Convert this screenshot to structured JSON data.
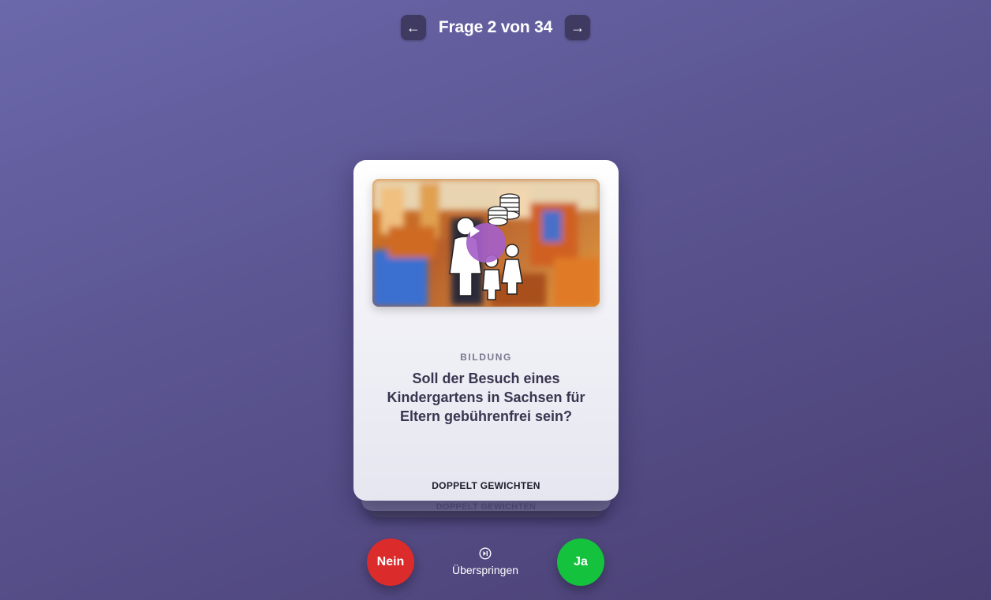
{
  "nav": {
    "prev_icon": "←",
    "next_icon": "→",
    "title": "Frage 2 von 34"
  },
  "card": {
    "thumbnail_icon": "play-icon",
    "category": "BILDUNG",
    "question": "Soll der Besuch eines Kindergartens in Sachsen für Eltern gebührenfrei sein?",
    "weight_label": "DOPPELT GEWICHTEN"
  },
  "stack": {
    "next_card_weight_label": "DOPPELT GEWICHTEN"
  },
  "actions": {
    "no_label": "Nein",
    "skip_label": "Überspringen",
    "yes_label": "Ja"
  },
  "colors": {
    "no": "#dc2b2b",
    "yes": "#14c23d",
    "play": "#a55fc8",
    "nav_button": "#3e3a62"
  }
}
